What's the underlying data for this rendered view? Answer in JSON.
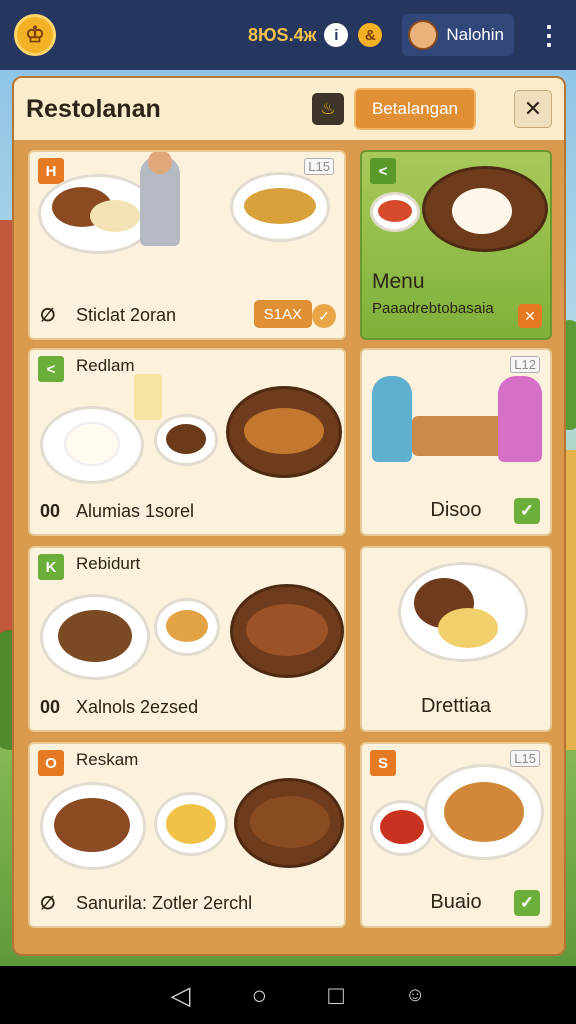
{
  "topbar": {
    "coins": "8ЮS.4ж",
    "player_name": "Nalohin"
  },
  "panel": {
    "title": "Restolanan",
    "action_button": "Betalangan"
  },
  "cards": [
    {
      "tag": "H",
      "caption": "Sticlat 2oran",
      "price": "S1AX",
      "badge": "L15"
    },
    {
      "tag": "<",
      "title": "Menu",
      "subtitle": "Paaadrebtobasaia"
    },
    {
      "tag": "<",
      "name": "Redlam",
      "caption": "Alumias 1sorel"
    },
    {
      "badge": "L12",
      "caption": "Disoo"
    },
    {
      "tag": "K",
      "name": "Rebidurt",
      "caption": "Xalnols 2ezsed"
    },
    {
      "caption": "Drettiaa"
    },
    {
      "tag": "O",
      "name": "Reskam",
      "caption": "Sanurila: Zotler 2erchl"
    },
    {
      "tag": "S",
      "badge": "L15",
      "caption": "Buaio"
    }
  ],
  "icons": {
    "logo": "chef-hat-icon",
    "info": "info-icon",
    "gold": "gold-coin-icon",
    "menu": "kebab-menu-icon",
    "back": "back-icon",
    "home": "home-icon",
    "recents": "recents-icon"
  },
  "colors": {
    "topbar": "#26375f",
    "panel": "#d99a4e",
    "accent": "#e08f34",
    "check": "#6cae3a"
  }
}
